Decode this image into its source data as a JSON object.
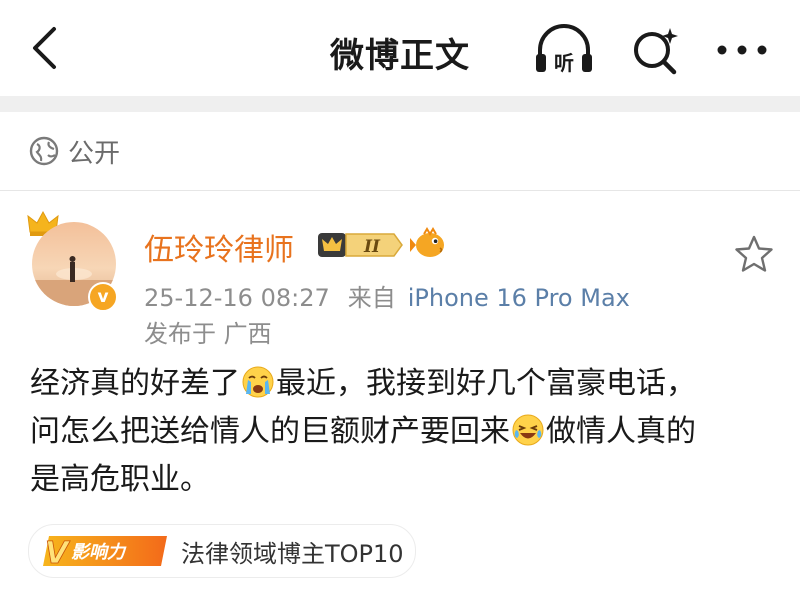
{
  "header": {
    "title": "微博正文",
    "listen_label": "听"
  },
  "visibility": {
    "label": "公开"
  },
  "post": {
    "author": "伍玲玲律师",
    "vip_level": "II",
    "verified_mark": "v",
    "timestamp": "25-12-16 08:27",
    "source_prefix": "来自",
    "device": "iPhone 16 Pro Max",
    "location": "发布于 广西",
    "text_part1": "经济真的好差了",
    "text_part2": "最近，我接到好几个富豪电话，",
    "text_part3": "问怎么把送给情人的巨额财产要回来",
    "text_part4": "做情人真的",
    "text_part5": "是高危职业。"
  },
  "influence": {
    "badge_letter": "V",
    "badge_label": "影响力",
    "text": "法律领域博主TOP10"
  },
  "colors": {
    "author": "#e8731e",
    "device": "#5b7fa8",
    "meta": "#8d8d8d",
    "badge_orange": "#f6a623"
  }
}
